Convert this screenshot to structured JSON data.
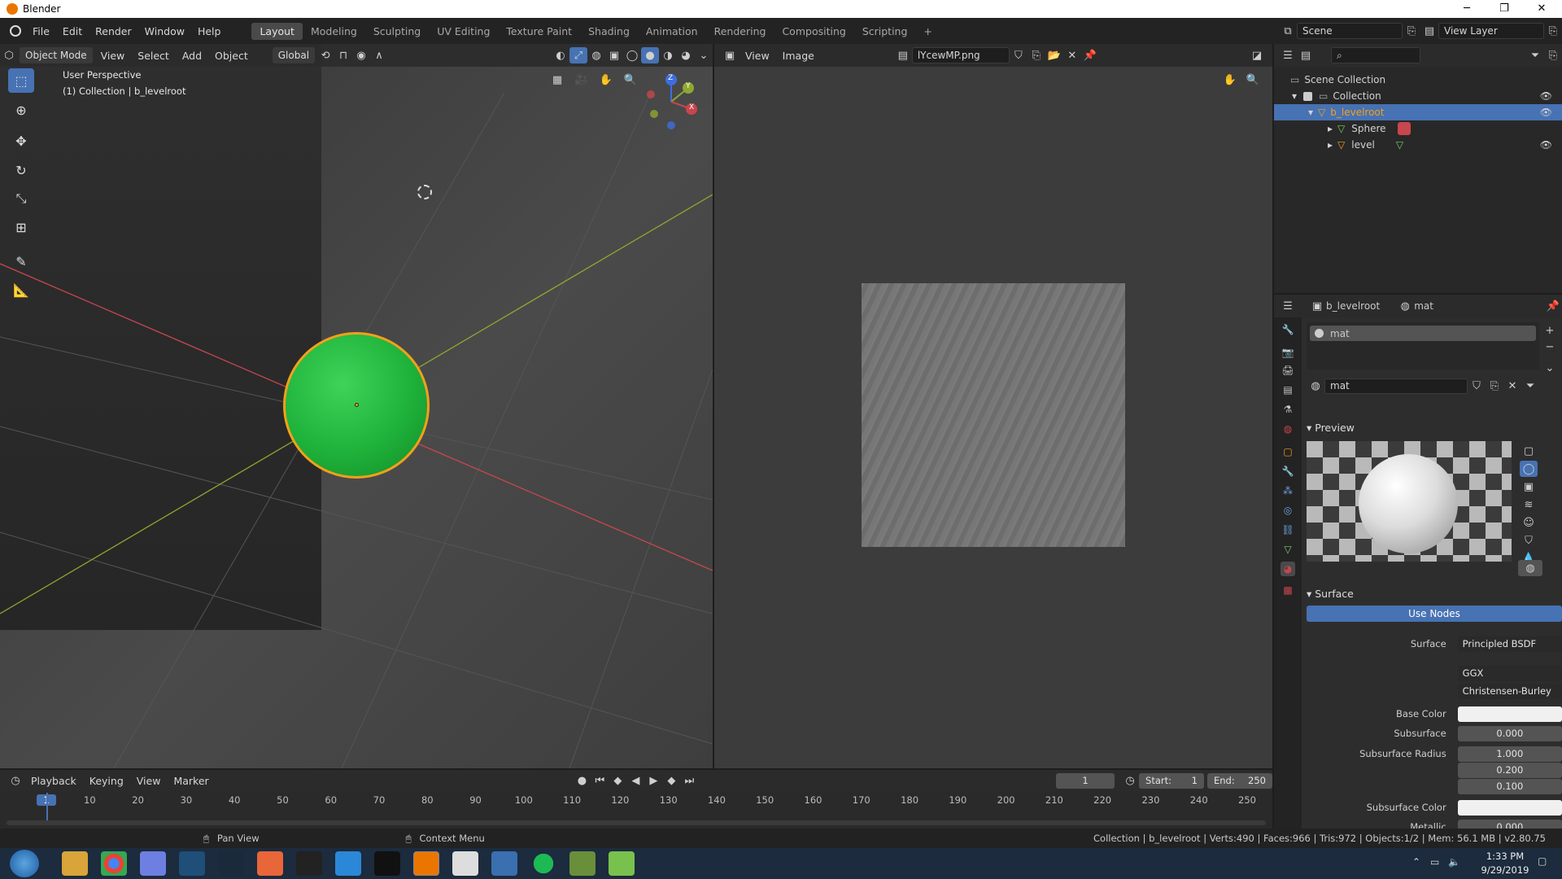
{
  "window": {
    "title": "Blender"
  },
  "menu": [
    "File",
    "Edit",
    "Render",
    "Window",
    "Help"
  ],
  "workspaces": [
    "Layout",
    "Modeling",
    "Sculpting",
    "UV Editing",
    "Texture Paint",
    "Shading",
    "Animation",
    "Rendering",
    "Compositing",
    "Scripting"
  ],
  "workspace_add": "+",
  "scene": {
    "name": "Scene",
    "view_layer": "View Layer"
  },
  "viewport": {
    "mode": "Object Mode",
    "menus": [
      "View",
      "Select",
      "Add",
      "Object"
    ],
    "orientation": "Global",
    "info_line1": "User Perspective",
    "info_line2": "(1) Collection | b_levelroot",
    "gizmo": {
      "z": "Z",
      "y": "Y",
      "x": "X"
    }
  },
  "image_editor": {
    "menus": [
      "View",
      "Image"
    ],
    "image_name": "lYcewMP.png"
  },
  "outliner": {
    "root": "Scene Collection",
    "items": [
      {
        "label": "Collection"
      },
      {
        "label": "b_levelroot"
      },
      {
        "label": "Sphere"
      },
      {
        "label": "level"
      }
    ]
  },
  "properties": {
    "breadcrumb_object": "b_levelroot",
    "breadcrumb_material": "mat",
    "slot": "mat",
    "material_name": "mat",
    "preview_header": "Preview",
    "surface_header": "Surface",
    "use_nodes": "Use Nodes",
    "rows": [
      {
        "label": "Surface",
        "value": "Principled BSDF"
      },
      {
        "label": "",
        "value": "GGX"
      },
      {
        "label": "",
        "value": "Christensen-Burley"
      },
      {
        "label": "Base Color",
        "value": ""
      },
      {
        "label": "Subsurface",
        "value": "0.000"
      },
      {
        "label": "Subsurface Radius",
        "value": "1.000"
      },
      {
        "label": "",
        "value": "0.200"
      },
      {
        "label": "",
        "value": "0.100"
      },
      {
        "label": "Subsurface Color",
        "value": ""
      },
      {
        "label": "Metallic",
        "value": "0.000"
      }
    ]
  },
  "timeline": {
    "menus": [
      "Playback",
      "Keying",
      "View",
      "Marker"
    ],
    "current_frame": "1",
    "start_label": "Start:",
    "start": "1",
    "end_label": "End:",
    "end": "250",
    "ticks": [
      "1",
      "10",
      "20",
      "30",
      "40",
      "50",
      "60",
      "70",
      "80",
      "90",
      "100",
      "110",
      "120",
      "130",
      "140",
      "150",
      "160",
      "170",
      "180",
      "190",
      "200",
      "210",
      "220",
      "230",
      "240",
      "250"
    ]
  },
  "statusbar": {
    "left_hint": "Pan View",
    "mid_hint": "Context Menu",
    "stats": "Collection | b_levelroot | Verts:490 | Faces:966 | Tris:972 | Objects:1/2 | Mem: 56.1 MB | v2.80.75"
  },
  "taskbar": {
    "time": "1:33 PM",
    "date": "9/29/2019"
  },
  "colors": {
    "accent": "#4772b3",
    "sphere": "#1fb23a",
    "selection_outline": "#f5a019",
    "x_axis": "#c8464e",
    "y_axis": "#8fa82f"
  }
}
